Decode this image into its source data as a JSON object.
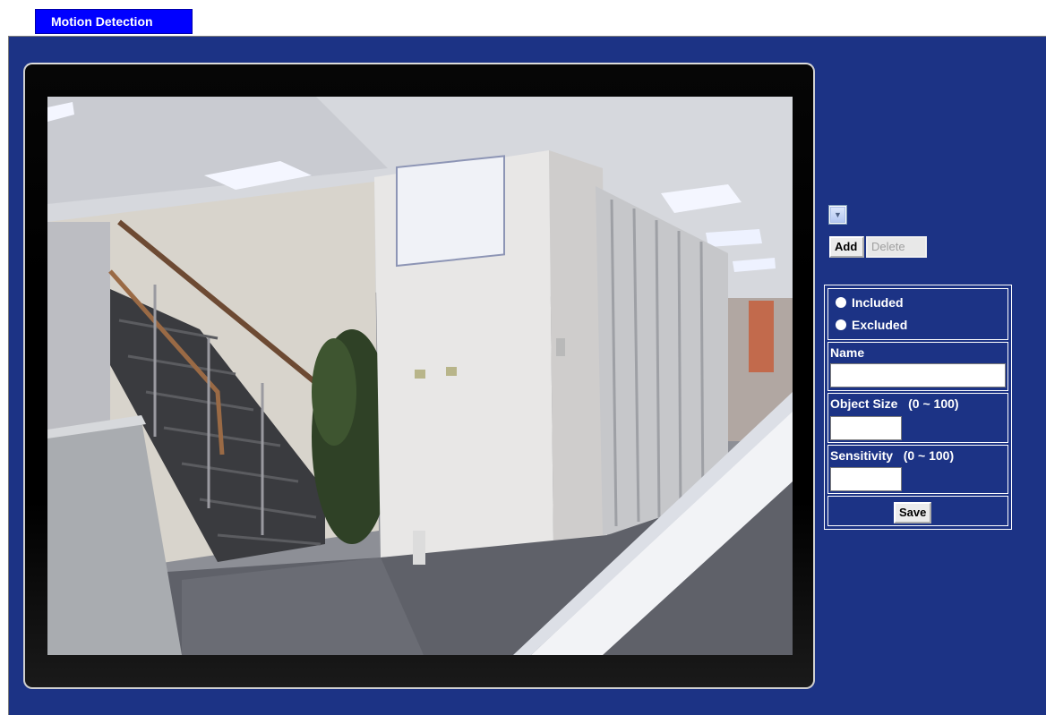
{
  "tab": {
    "label": "Motion Detection"
  },
  "colors": {
    "tab": "#0000ff",
    "panel_bg": "#1c3385",
    "border": "#ffffff"
  },
  "video": {
    "description_icon": "camera-feed"
  },
  "window_select": {
    "value": ""
  },
  "buttons": {
    "add": "Add",
    "delete": "Delete",
    "save": "Save"
  },
  "region_mode": {
    "included": "Included",
    "excluded": "Excluded"
  },
  "fields": {
    "name_label": "Name",
    "name_value": "",
    "object_size_label": "Object Size   (0 ~ 100)",
    "object_size_value": "",
    "sensitivity_label": "Sensitivity   (0 ~ 100)",
    "sensitivity_value": ""
  }
}
